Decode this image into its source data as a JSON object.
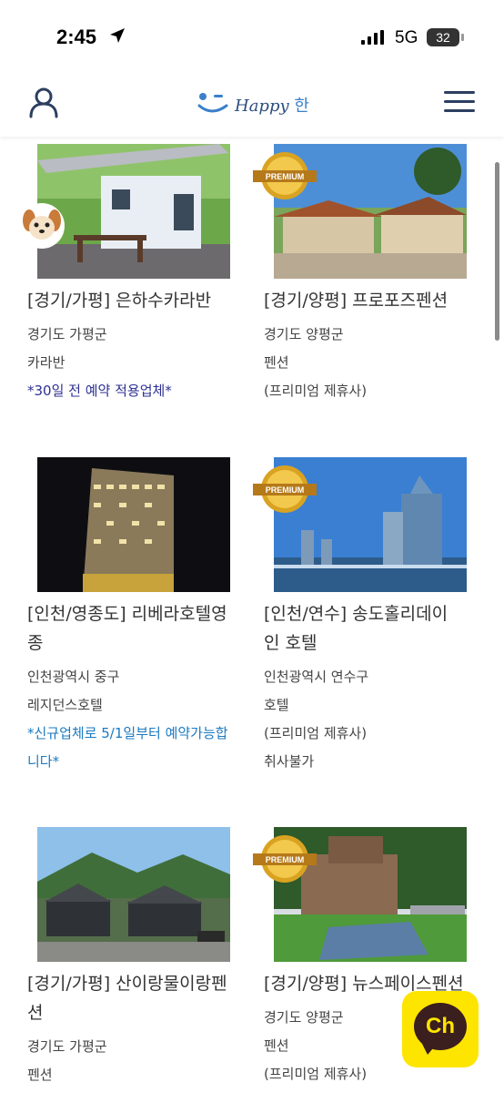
{
  "status_bar": {
    "time": "2:45",
    "network": "5G",
    "battery": "32"
  },
  "header": {
    "logo_text": "Happy",
    "logo_han": "한"
  },
  "colors": {
    "navy_note": "#2e3192",
    "blue_note": "#1b7ac0",
    "brand": "#2c4e7c",
    "kakao_yellow": "#fee500"
  },
  "listings": [
    {
      "title": "[경기/가평] 은하수카라반",
      "region": "경기도 가평군",
      "type": "카라반",
      "extra": [
        "*30일 전 예약 적용업체*"
      ],
      "premium": false
    },
    {
      "title": "[경기/양평] 프로포즈펜션",
      "region": "경기도 양평군",
      "type": "펜션",
      "extra": [
        "(프리미엄 제휴사)"
      ],
      "premium": true
    },
    {
      "title_lines": [
        "[인천/영종도] 리베라호텔영",
        "종"
      ],
      "region": "인천광역시 중구",
      "type": "레지던스호텔",
      "extra_lines": [
        "*신규업체로 5/1일부터 예약가능합",
        "니다*"
      ],
      "premium": false
    },
    {
      "title_lines": [
        "[인천/연수] 송도홀리데이",
        "인 호텔"
      ],
      "region": "인천광역시 연수구",
      "type": "호텔",
      "extra": [
        "(프리미엄 제휴사)",
        "취사불가"
      ],
      "premium": true
    },
    {
      "title_lines": [
        "[경기/가평] 산이랑물이랑펜",
        "션"
      ],
      "region": "경기도 가평군",
      "type": "펜션",
      "premium": false
    },
    {
      "title": "[경기/양평] 뉴스페이스펜션",
      "region": "경기도 양평군",
      "type": "펜션",
      "extra": [
        "(프리미엄 제휴사)"
      ],
      "premium": true
    }
  ],
  "premium_badge": "PREMIUM",
  "chat_button": {
    "label": "Ch"
  }
}
